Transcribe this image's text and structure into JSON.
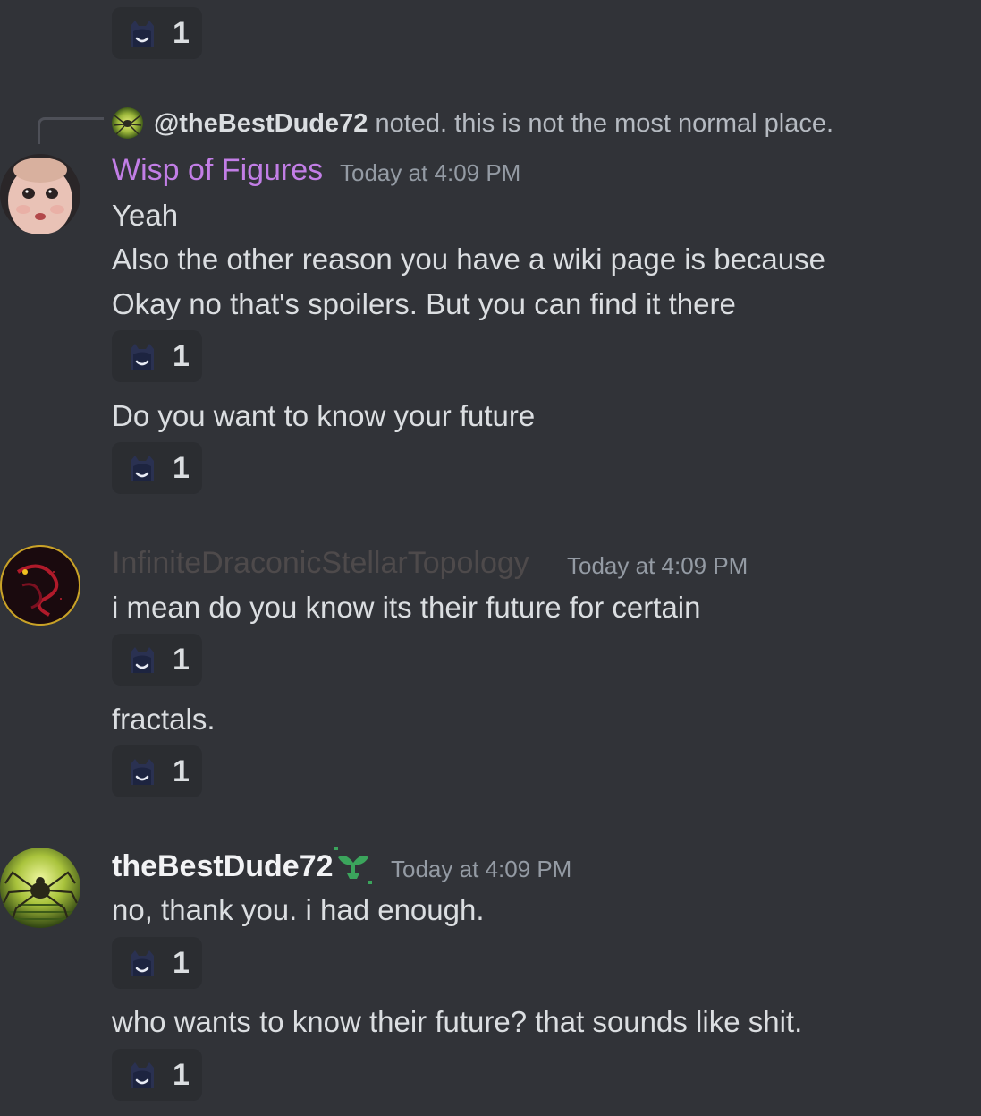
{
  "reactions": {
    "count": "1",
    "emoji_icon": "hooded-face-emoji-icon"
  },
  "reply": {
    "mention": "@theBestDude72",
    "text": "noted. this is not the most normal place."
  },
  "messages": [
    {
      "author": "Wisp of Figures",
      "author_color": "#c27ee6",
      "timestamp": "Today at 4:09 PM",
      "lines": [
        "Yeah",
        "Also the other reason you have a wiki page is because",
        "Okay no that's spoilers. But you can find it there"
      ],
      "followup": "Do you want to know your future"
    },
    {
      "author": "InfiniteDraconicStellarTopology",
      "author_color": "#4e4a4b",
      "timestamp": "Today at 4:09 PM",
      "lines": [
        "i mean do you know its their future for certain"
      ],
      "followup": "fractals."
    },
    {
      "author": "theBestDude72",
      "author_color": "#f2f3f5",
      "timestamp": "Today at 4:09 PM",
      "lines": [
        "no, thank you. i had enough."
      ],
      "followup": "who wants to know their future? that sounds like shit.",
      "badge_icon": "sprout-badge-icon"
    }
  ]
}
